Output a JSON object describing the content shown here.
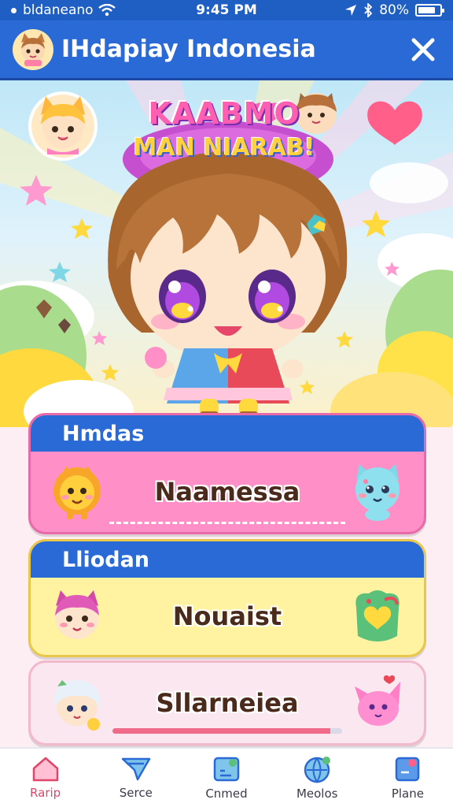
{
  "status_bar": {
    "carrier": "bldaneano",
    "time": "9:45 PM",
    "battery": "80%",
    "battery_level": 0.8
  },
  "header": {
    "title": "IHdapiay Indonesia",
    "close_icon": "close-icon",
    "avatar_icon": "cat-avatar-icon"
  },
  "hero": {
    "title_line1": "KAABMO",
    "title_line2": "MAN NIARAB!"
  },
  "cards": [
    {
      "header": "Hmdas",
      "label": "Naamessa",
      "left_icon": "lion-mascot-icon",
      "right_icon": "cat-mascot-icon",
      "color": "#ff8fc6"
    },
    {
      "header": "Lliodan",
      "label": "Nouaist",
      "left_icon": "pink-cat-mascot-icon",
      "right_icon": "heart-bird-icon",
      "color": "#fff3a2"
    },
    {
      "label": "Sllarneiea",
      "left_icon": "white-hair-mascot-icon",
      "right_icon": "pink-fox-icon",
      "progress": 0.95,
      "color": "#fbe7ef"
    }
  ],
  "bottom_nav": [
    {
      "label": "Rarip",
      "icon": "home-icon",
      "active": true
    },
    {
      "label": "Serce",
      "icon": "send-icon",
      "active": false
    },
    {
      "label": "Cnmed",
      "icon": "edit-icon",
      "active": false
    },
    {
      "label": "Meolos",
      "icon": "globe-icon",
      "active": false
    },
    {
      "label": "Plane",
      "icon": "notebook-icon",
      "active": false
    }
  ],
  "colors": {
    "primary_blue": "#2a6ad6",
    "pink": "#ff8fc6",
    "yellow": "#fff3a2",
    "active_nav": "#e0456a"
  }
}
